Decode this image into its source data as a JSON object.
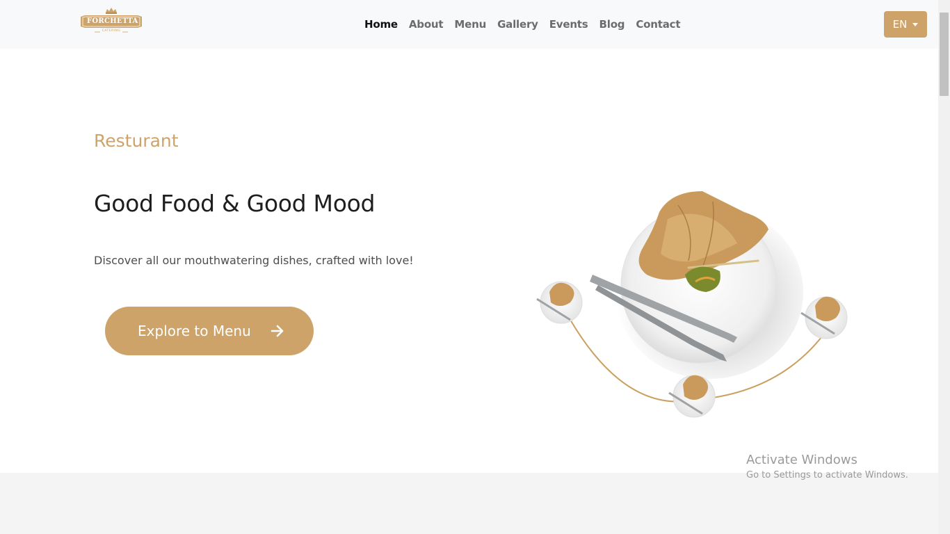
{
  "brand": {
    "name": "FORCHETTA",
    "tagline": "CATERING",
    "color": "#cda36a"
  },
  "nav": {
    "items": [
      {
        "label": "Home",
        "active": true
      },
      {
        "label": "About"
      },
      {
        "label": "Menu"
      },
      {
        "label": "Gallery"
      },
      {
        "label": "Events"
      },
      {
        "label": "Blog"
      },
      {
        "label": "Contact"
      }
    ]
  },
  "language": {
    "selected": "EN",
    "icon": "caret-down-icon"
  },
  "hero": {
    "eyebrow": "Resturant",
    "headline": "Good Food & Good Mood",
    "subtext": "Discover all our mouthwatering dishes, crafted with love!",
    "cta_label": "Explore to Menu",
    "cta_icon": "arrow-right-icon"
  },
  "watermark": {
    "title": "Activate Windows",
    "subtitle": "Go to Settings to activate Windows."
  }
}
